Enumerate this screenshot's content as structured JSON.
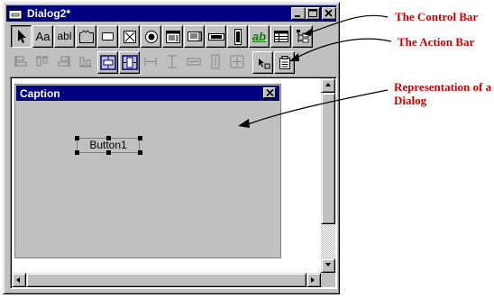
{
  "window": {
    "title": "Dialog2*",
    "controls": [
      {
        "name": "minimize-button",
        "icon": "minimize-icon"
      },
      {
        "name": "maximize-button",
        "icon": "maximize-icon"
      },
      {
        "name": "close-button",
        "icon": "close-icon"
      }
    ]
  },
  "control_bar": {
    "tools": [
      {
        "id": "pointer",
        "icon": "pointer-arrow-icon",
        "label": "",
        "pressed": true
      },
      {
        "id": "label",
        "icon": "static-text-icon",
        "label": "Aa"
      },
      {
        "id": "edit",
        "icon": "edit-field-icon",
        "label": "abl"
      },
      {
        "id": "groupbox",
        "icon": "group-box-icon",
        "label": ""
      },
      {
        "id": "button",
        "icon": "push-button-icon",
        "label": ""
      },
      {
        "id": "checkbox",
        "icon": "checkbox-icon",
        "label": ""
      },
      {
        "id": "radio",
        "icon": "radio-button-icon",
        "label": ""
      },
      {
        "id": "combobox",
        "icon": "combo-box-icon",
        "label": ""
      },
      {
        "id": "listbox",
        "icon": "list-box-icon",
        "label": ""
      },
      {
        "id": "hscroll",
        "icon": "horizontal-scrollbar-icon",
        "label": ""
      },
      {
        "id": "vscroll",
        "icon": "vertical-scrollbar-icon",
        "label": ""
      },
      {
        "id": "richtext",
        "icon": "rich-text-icon",
        "label": "ab"
      },
      {
        "id": "grid",
        "icon": "grid-control-icon",
        "label": ""
      },
      {
        "id": "tree",
        "icon": "tree-view-icon",
        "label": ""
      }
    ]
  },
  "action_bar": {
    "tools": [
      {
        "id": "align-left",
        "icon": "align-left-icon",
        "enabled": false
      },
      {
        "id": "align-top",
        "icon": "align-top-icon",
        "enabled": false
      },
      {
        "id": "align-right",
        "icon": "align-right-icon",
        "enabled": false
      },
      {
        "id": "align-bottom",
        "icon": "align-bottom-icon",
        "enabled": false
      },
      {
        "id": "center-vertical",
        "icon": "center-vertical-icon",
        "enabled": true
      },
      {
        "id": "center-horizontal",
        "icon": "center-horizontal-icon",
        "enabled": true
      },
      {
        "id": "space-horizontal",
        "icon": "space-horizontal-icon",
        "enabled": false
      },
      {
        "id": "space-vertical",
        "icon": "space-vertical-icon",
        "enabled": false
      },
      {
        "id": "same-width",
        "icon": "same-width-icon",
        "enabled": false
      },
      {
        "id": "same-height",
        "icon": "same-height-icon",
        "enabled": false
      },
      {
        "id": "same-size",
        "icon": "same-size-icon",
        "enabled": false
      },
      {
        "id": "tab-order",
        "icon": "tab-order-icon",
        "enabled": true
      },
      {
        "id": "properties",
        "icon": "properties-icon",
        "enabled": true
      }
    ]
  },
  "dialog_preview": {
    "caption": "Caption",
    "button_label": "Button1"
  },
  "annotations": {
    "control_bar": "The Control Bar",
    "action_bar": "The Action Bar",
    "representation_line1": "Representation of a",
    "representation_line2": "Dialog"
  },
  "colors": {
    "titlebar": "#000080",
    "face": "#c0c0c0",
    "annotation": "#cc0000"
  }
}
